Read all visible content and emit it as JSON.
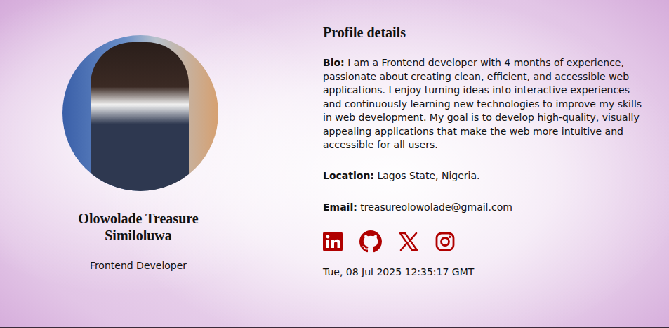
{
  "profile": {
    "name": "Olowolade Treasure Similoluwa",
    "role": "Frontend Developer"
  },
  "details": {
    "heading": "Profile details",
    "fields": [
      {
        "label": "Bio:",
        "value": "I am a Frontend developer with 4 months of experience, passionate about creating clean, efficient, and accessible web applications. I enjoy turning ideas into interactive experiences and continuously learning new technologies to improve my skills in web development. My goal is to develop high-quality, visually appealing applications that make the web more intuitive and accessible for all users."
      },
      {
        "label": "Location:",
        "value": "Lagos State, Nigeria."
      },
      {
        "label": "Email:",
        "value": "treasureolowolade@gmail.com"
      }
    ],
    "timestamp": "Tue, 08 Jul 2025 12:35:17 GMT"
  }
}
